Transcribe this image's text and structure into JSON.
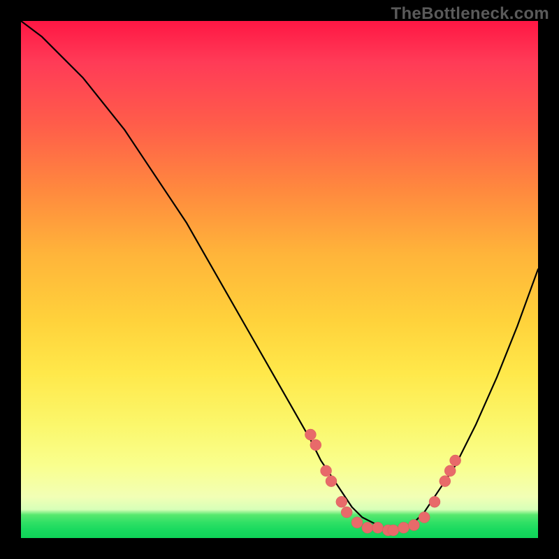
{
  "watermark": "TheBottleneck.com",
  "colors": {
    "dot": "#e86a6a",
    "curve": "#000000",
    "frame": "#000000"
  },
  "chart_data": {
    "type": "line",
    "title": "",
    "xlabel": "",
    "ylabel": "",
    "xlim": [
      0,
      100
    ],
    "ylim": [
      0,
      100
    ],
    "grid": false,
    "note": "No axis tick labels or numeric values are rendered in the image; curve and marker y-values below are estimated from pixel positions as percent of plot height (0 = bottom, 100 = top).",
    "series": [
      {
        "name": "bottleneck-curve",
        "x": [
          0,
          4,
          8,
          12,
          16,
          20,
          24,
          28,
          32,
          36,
          40,
          44,
          48,
          52,
          56,
          58,
          60,
          62,
          64,
          66,
          68,
          70,
          72,
          74,
          76,
          78,
          80,
          84,
          88,
          92,
          96,
          100
        ],
        "y": [
          100,
          97,
          93,
          89,
          84,
          79,
          73,
          67,
          61,
          54,
          47,
          40,
          33,
          26,
          19,
          15,
          12,
          9,
          6,
          4,
          3,
          2,
          2,
          2,
          3,
          5,
          8,
          14,
          22,
          31,
          41,
          52
        ]
      }
    ],
    "markers": [
      {
        "x": 56,
        "y": 20
      },
      {
        "x": 57,
        "y": 18
      },
      {
        "x": 59,
        "y": 13
      },
      {
        "x": 60,
        "y": 11
      },
      {
        "x": 62,
        "y": 7
      },
      {
        "x": 63,
        "y": 5
      },
      {
        "x": 65,
        "y": 3
      },
      {
        "x": 67,
        "y": 2
      },
      {
        "x": 69,
        "y": 2
      },
      {
        "x": 71,
        "y": 1.5
      },
      {
        "x": 72,
        "y": 1.5
      },
      {
        "x": 74,
        "y": 2
      },
      {
        "x": 76,
        "y": 2.5
      },
      {
        "x": 78,
        "y": 4
      },
      {
        "x": 80,
        "y": 7
      },
      {
        "x": 82,
        "y": 11
      },
      {
        "x": 83,
        "y": 13
      },
      {
        "x": 84,
        "y": 15
      }
    ]
  }
}
